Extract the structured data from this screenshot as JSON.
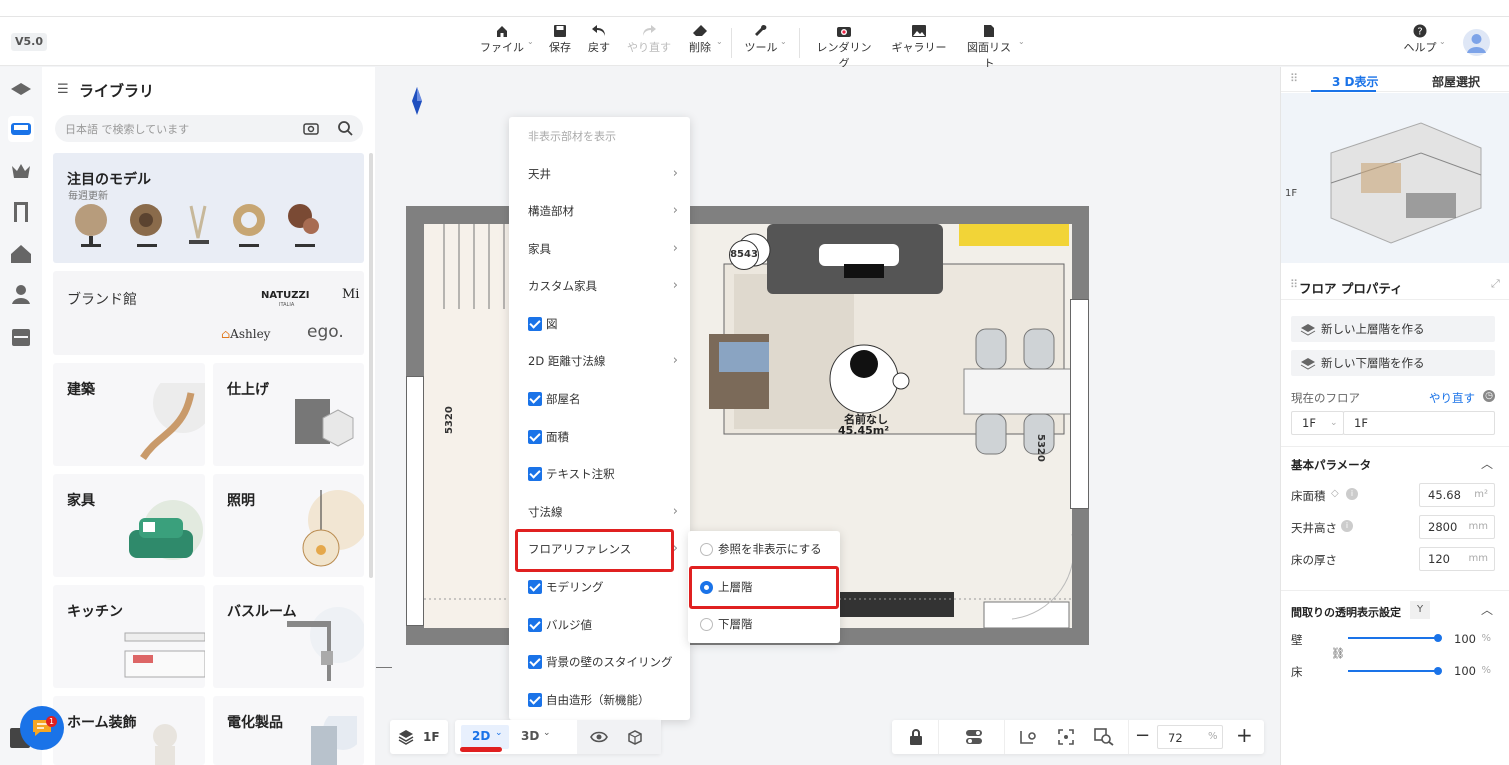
{
  "app": {
    "version": "V5.0"
  },
  "toolbar": {
    "file": "ファイル",
    "save": "保存",
    "undo": "戻す",
    "redo": "やり直す",
    "delete": "削除",
    "tools": "ツール",
    "render": "レンダリング",
    "gallery": "ギャラリー",
    "plans": "図面リスト",
    "help": "ヘルプ"
  },
  "library": {
    "title": "ライブラリ",
    "search_placeholder": "日本語 で検索しています",
    "featured_title": "注目のモデル",
    "featured_sub": "毎週更新",
    "brand_title": "ブランド館",
    "brands": [
      "NATUZZI",
      "ITALIA",
      "Mi",
      "Ashley",
      "ego."
    ],
    "categories": [
      "建築",
      "仕上げ",
      "家具",
      "照明",
      "キッチン",
      "バスルーム",
      "ホーム装飾",
      "電化製品"
    ]
  },
  "menu": {
    "header": "非表示部材を表示",
    "items": [
      {
        "label": "天井",
        "checked": null,
        "submenu": true
      },
      {
        "label": "構造部材",
        "checked": null,
        "submenu": true
      },
      {
        "label": "家具",
        "checked": null,
        "submenu": true
      },
      {
        "label": "カスタム家具",
        "checked": null,
        "submenu": true
      },
      {
        "label": "図",
        "checked": true,
        "submenu": false
      },
      {
        "label": "2D 距離寸法線",
        "checked": null,
        "submenu": true
      },
      {
        "label": "部屋名",
        "checked": true,
        "submenu": false
      },
      {
        "label": "面積",
        "checked": true,
        "submenu": false
      },
      {
        "label": "テキスト注釈",
        "checked": true,
        "submenu": false
      },
      {
        "label": "寸法線",
        "checked": null,
        "submenu": true
      },
      {
        "label": "フロアリファレンス",
        "checked": null,
        "submenu": true
      },
      {
        "label": "モデリング",
        "checked": true,
        "submenu": false
      },
      {
        "label": "バルジ値",
        "checked": true,
        "submenu": false
      },
      {
        "label": "背景の壁のスタイリング",
        "checked": true,
        "submenu": false
      },
      {
        "label": "自由造形（新機能）",
        "checked": true,
        "submenu": false
      }
    ]
  },
  "submenu": {
    "items": [
      {
        "label": "参照を非表示にする",
        "selected": false
      },
      {
        "label": "上層階",
        "selected": true
      },
      {
        "label": "下層階",
        "selected": false
      }
    ]
  },
  "plan": {
    "room_name": "名前なし",
    "room_area": "45.45m²",
    "dim_left": "5320",
    "dim_right": "5320",
    "tag": "8543"
  },
  "right": {
    "tab_3d": "3 D表示",
    "tab_room": "部屋選択",
    "floor_label": "1F",
    "props_title": "フロア プロパティ",
    "new_upper": "新しい上層階を作る",
    "new_lower": "新しい下層階を作る",
    "current_floor": "現在のフロア",
    "redo": "やり直す",
    "floor_select": "1F",
    "floor_name": "1F",
    "params_title": "基本パラメータ",
    "floor_area_label": "床面積",
    "floor_area_value": "45.68",
    "floor_area_unit": "m²",
    "ceiling_label": "天井高さ",
    "ceiling_value": "2800",
    "ceiling_unit": "mm",
    "thickness_label": "床の厚さ",
    "thickness_value": "120",
    "thickness_unit": "mm",
    "transparency_title": "間取りの透明表示設定",
    "transparency_key": "Y",
    "wall_label": "壁",
    "wall_value": "100",
    "wall_unit": "%",
    "floor_label2": "床",
    "floor_value": "100",
    "floor_unit": "%",
    "wall_level": 1.0,
    "floor_level": 1.0
  },
  "bottom": {
    "floor": "1F",
    "mode2d": "2D",
    "mode3d": "3D",
    "zoom": "72",
    "zoom_unit": "%"
  },
  "chat": {
    "badge": "1"
  }
}
